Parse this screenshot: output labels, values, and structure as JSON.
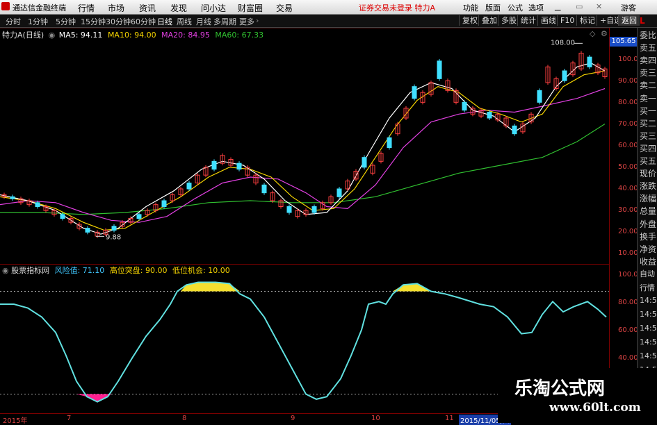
{
  "app": {
    "title": "通达信金融终端"
  },
  "menu": {
    "items": [
      "行情",
      "市场",
      "资讯",
      "发现",
      "问小达",
      "财富圈",
      "交易"
    ],
    "warning": "证券交易未登录 特力A",
    "right": [
      "功能",
      "版面",
      "公式",
      "选项"
    ],
    "guest": "游客"
  },
  "tabs": {
    "periods": [
      "分时",
      "1分钟",
      "5分钟",
      "15分钟",
      "30分钟",
      "60分钟",
      "日线",
      "周线",
      "月线",
      "多周期",
      "更多"
    ],
    "active": "日线",
    "right_buttons": [
      "复权",
      "叠加",
      "多股",
      "统计",
      "画线",
      "F10",
      "标记",
      "+自选",
      "返回"
    ]
  },
  "main": {
    "stock_label": "特力A(日线)",
    "ma": [
      {
        "label": "MA5: 94.11",
        "color": "#ffffff"
      },
      {
        "label": "MA10: 94.00",
        "color": "#f5d400"
      },
      {
        "label": "MA20: 84.95",
        "color": "#e040e0"
      },
      {
        "label": "MA60: 67.33",
        "color": "#30c030"
      }
    ],
    "price_tag": "105.65",
    "high_label": "108.00",
    "low_label": "9.88",
    "yticks": [
      "100.00",
      "90.00",
      "80.00",
      "70.00",
      "60.00",
      "50.00",
      "40.00",
      "30.00",
      "20.00",
      "10.00"
    ]
  },
  "indicator": {
    "name": "股票指标网",
    "values": [
      {
        "label": "风险值: 71.10",
        "color": "#40c8ff"
      },
      {
        "label": "高位突盘: 90.00",
        "color": "#f5d400"
      },
      {
        "label": "低位机会: 10.00",
        "color": "#f5d400"
      }
    ],
    "yticks": [
      "100.00",
      "80.00",
      "60.00",
      "40.00"
    ]
  },
  "side_panel": {
    "items": [
      "委比",
      "卖五",
      "卖四",
      "卖三",
      "卖二",
      "卖一",
      "买一",
      "买二",
      "买三",
      "买四",
      "买五",
      "现价",
      "涨跌",
      "涨幅",
      "总量",
      "外盘",
      "换手",
      "净资",
      "收益"
    ],
    "items2": [
      "自动",
      "行情",
      "14:50",
      "14:50",
      "14:50",
      "14:50",
      "14:50",
      "14:50"
    ]
  },
  "dates": {
    "labels": [
      "2015年",
      "7",
      "8",
      "9",
      "10",
      "11"
    ],
    "highlight": "2015/11/05/四"
  },
  "watermark": {
    "line1": "乐淘公式网",
    "line2": "www.60lt.com"
  }
}
